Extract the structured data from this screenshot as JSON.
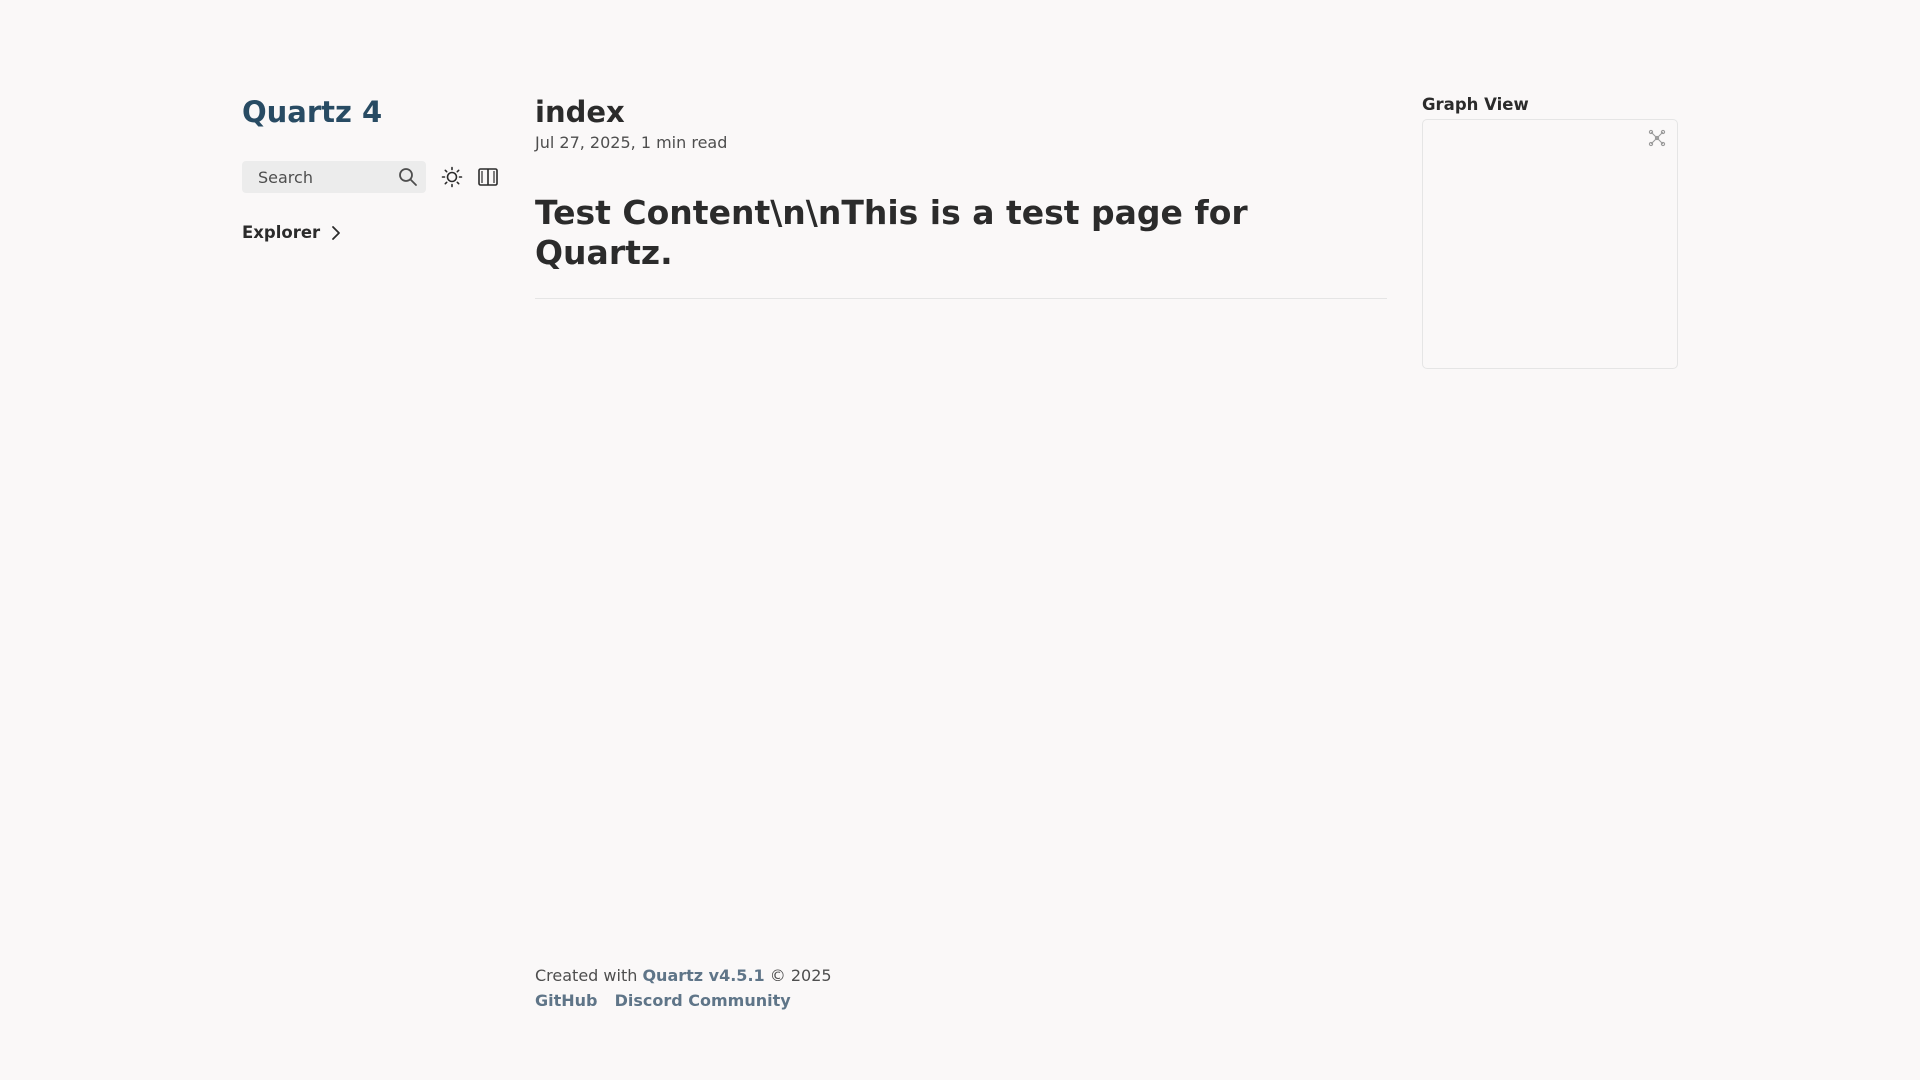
{
  "sidebar": {
    "site_title": "Quartz 4",
    "search_label": "Search",
    "explorer_label": "Explorer"
  },
  "article": {
    "title": "index",
    "date": "Jul 27, 2025",
    "reading_time": "1 min read",
    "heading": "Test Content\\n\\nThis is a test page for Quartz."
  },
  "graph": {
    "title": "Graph View"
  },
  "footer": {
    "created_prefix": "Created with",
    "quartz_link": "Quartz v4.5.1",
    "copyright": "© 2025",
    "links": [
      "GitHub",
      "Discord Community"
    ]
  },
  "colors": {
    "background": "#faf8f8",
    "title_accent": "#284b63",
    "footer_link": "#5f7588"
  }
}
